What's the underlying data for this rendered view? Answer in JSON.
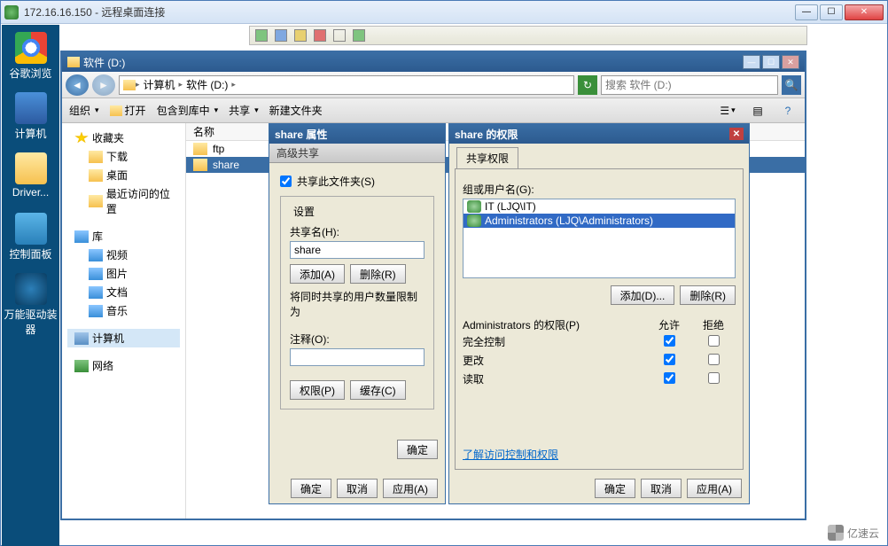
{
  "rdp": {
    "title": "172.16.16.150 - 远程桌面连接"
  },
  "desktop": {
    "icons": [
      "谷歌浏览",
      "计算机",
      "Driver...",
      "控制面板",
      "万能驱动装器"
    ]
  },
  "explorer": {
    "title": "软件 (D:)",
    "breadcrumb": {
      "seg1": "计算机",
      "seg2": "软件 (D:)"
    },
    "search_placeholder": "搜索 软件 (D:)",
    "toolbar": {
      "org": "组织",
      "open": "打开",
      "include": "包含到库中",
      "share": "共享",
      "newfolder": "新建文件夹"
    },
    "sidebar": {
      "fav": "收藏夹",
      "fav_items": [
        "下载",
        "桌面",
        "最近访问的位置"
      ],
      "lib": "库",
      "lib_items": [
        "视频",
        "图片",
        "文档",
        "音乐"
      ],
      "computer": "计算机",
      "network": "网络"
    },
    "col_name": "名称",
    "files": {
      "ftp": "ftp",
      "share": "share"
    }
  },
  "props": {
    "title": "share 属性",
    "tab": "高级共享",
    "chk_label": "共享此文件夹(S)",
    "grp": "设置",
    "sharename_lbl": "共享名(H):",
    "sharename_val": "share",
    "add": "添加(A)",
    "remove": "删除(R)",
    "limit_lbl": "将同时共享的用户数量限制为",
    "comment_lbl": "注释(O):",
    "perm_btn": "权限(P)",
    "cache_btn": "缓存(C)",
    "ok": "确定",
    "cancel": "取消",
    "apply": "应用(A)"
  },
  "perm": {
    "title": "share 的权限",
    "tab": "共享权限",
    "group_lbl": "组或用户名(G):",
    "users": {
      "it": "IT (LJQ\\IT)",
      "admins": "Administrators (LJQ\\Administrators)"
    },
    "add": "添加(D)...",
    "remove": "删除(R)",
    "perm_for": "Administrators 的权限(P)",
    "allow": "允许",
    "deny": "拒绝",
    "rows": {
      "full": "完全控制",
      "change": "更改",
      "read": "读取"
    },
    "link": "了解访问控制和权限",
    "ok": "确定",
    "cancel": "取消",
    "apply": "应用(A)"
  },
  "watermark": "亿速云"
}
